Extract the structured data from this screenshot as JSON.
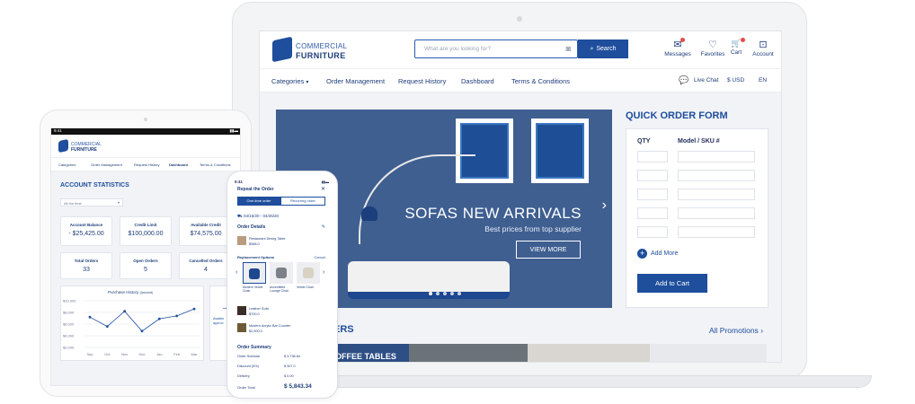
{
  "laptop": {
    "brand": {
      "line1": "COMMERCIAL",
      "line2": "FURNITURE"
    },
    "search": {
      "placeholder": "What are you looking for?",
      "button": "Search"
    },
    "header_icons": [
      {
        "name": "messages",
        "label": "Messages",
        "glyph": "✉"
      },
      {
        "name": "favorites",
        "label": "Favorites",
        "glyph": "♡"
      },
      {
        "name": "cart",
        "label": "Cart",
        "glyph": "🛒"
      },
      {
        "name": "account",
        "label": "Account",
        "glyph": "⊡"
      }
    ],
    "nav": {
      "items": [
        "Categories",
        "Order Management",
        "Request History",
        "Dashboard",
        "Terms & Conditions"
      ],
      "live_chat": "Live Chat",
      "currency": "$ USD",
      "language": "EN"
    },
    "hero": {
      "title": "SOFAS NEW ARRIVALS",
      "subtitle": "Best prices from top supplier",
      "cta": "VIEW MORE"
    },
    "quick_order": {
      "title": "QUICK ORDER FORM",
      "qty_header": "QTY",
      "sku_header": "Model / SKU #",
      "add_more": "Add More",
      "add_to_cart": "Add to Cart"
    },
    "promo": {
      "heading_fragment": "ERS",
      "link": "All Promotions",
      "tile_text": "OFFEE TABLES"
    }
  },
  "tablet": {
    "status_time": "9:41",
    "brand": {
      "line1": "COMMERCIAL",
      "line2": "FURNITURE"
    },
    "nav": [
      "Categories",
      "Order Management",
      "Request History",
      "Dashboard",
      "Terms & Conditions"
    ],
    "section_title": "ACCOUNT STATISTICS",
    "filter": "All the time",
    "stats": [
      {
        "label": "Account Balance",
        "value": "- $25,425.00"
      },
      {
        "label": "Credit Limit",
        "value": "$100,000.00"
      },
      {
        "label": "Available Credit",
        "value": "$74,575.00"
      },
      {
        "label": "Total Orders",
        "value": "33"
      },
      {
        "label": "Open Orders",
        "value": "5"
      },
      {
        "label": "Cancelled Orders",
        "value": "4"
      }
    ],
    "chart_title": "Purchase History",
    "chart_title_suffix": "(Amount)",
    "side_text": "Awaitin approv"
  },
  "chart_data": {
    "type": "line",
    "title": "Purchase History (Amount)",
    "categories": [
      "Sep",
      "Oct",
      "Nov",
      "Dec",
      "Jan",
      "Feb",
      "Mar"
    ],
    "y_ticks": [
      "$10,000",
      "$8,000",
      "$6,000",
      "$4,000",
      "$2,000"
    ],
    "ylim": [
      2000,
      10000
    ],
    "values": [
      7200,
      5600,
      8200,
      4800,
      6900,
      7400,
      8600
    ]
  },
  "phone": {
    "status_time": "9:41",
    "title": "Repeat the Order",
    "tabs": [
      "One-time order",
      "Recurring order"
    ],
    "dates": "04/15/20 - 04/26/20",
    "order_details": "Order Details",
    "item1": {
      "name": "Restaurant Dining Table",
      "price": "$368.0"
    },
    "replacement": "Replacement Options",
    "cancel": "Cancel",
    "options": [
      "Modern Velvet Chair",
      "Accentfleld Lounge Chair",
      "Velvet Chair"
    ],
    "item2": {
      "name": "Leather Sofa",
      "price": "$700.0"
    },
    "item3": {
      "name": "Modern Acrylic Bar Counter",
      "price": "$2,900.0"
    },
    "summary_title": "Order Summary",
    "summary": [
      {
        "label": "Order Subtotal",
        "value": "$ 3,738.84"
      },
      {
        "label": "Discount (5%)",
        "value": "$ 307.0"
      },
      {
        "label": "Delivery",
        "value": "$ 0.00"
      }
    ],
    "total_label": "Order Total",
    "total_value": "$ 5,843.34"
  }
}
